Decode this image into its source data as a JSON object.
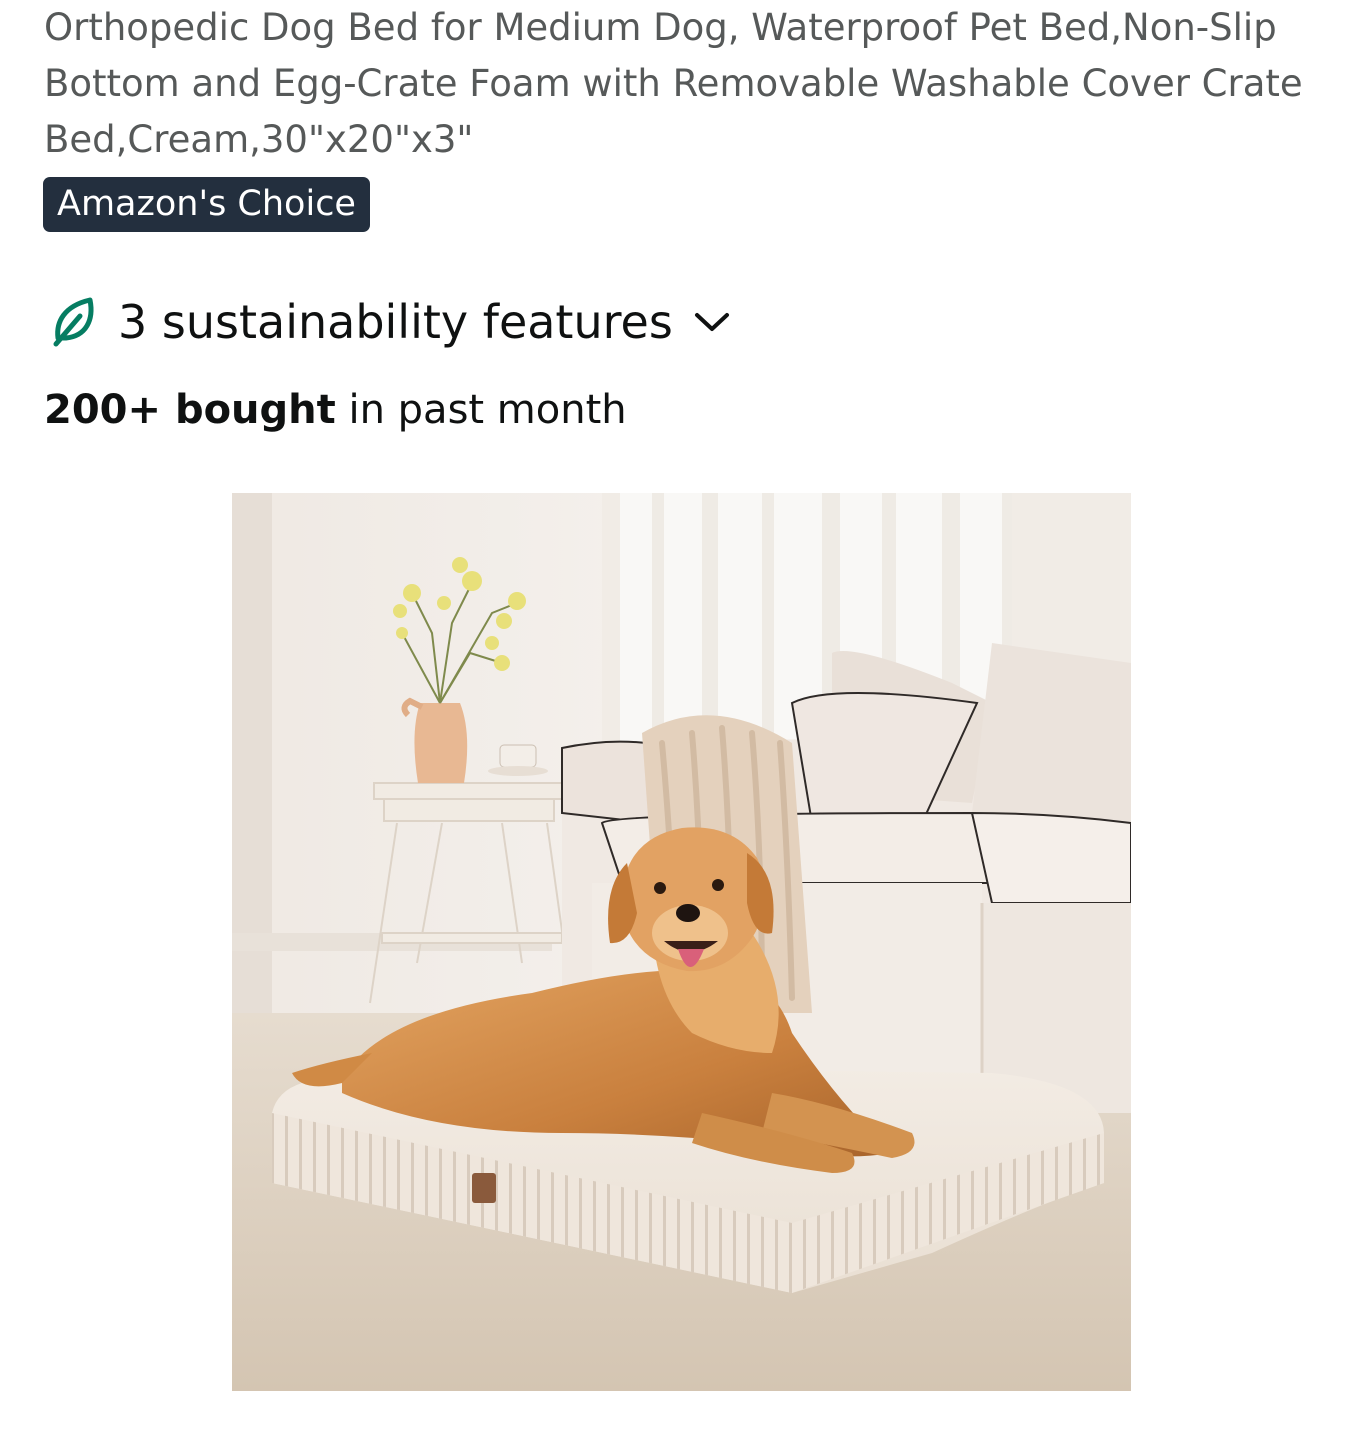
{
  "product": {
    "title": "Orthopedic Dog Bed for Medium Dog, Waterproof Pet Bed,Non-Slip Bottom and Egg-Crate Foam with Removable Washable Cover Crate Bed,Cream,30\"x20\"x3\"",
    "badge": "Amazon's Choice",
    "sustainability_label": "3 sustainability features",
    "sustainability_icon": "leaf-icon",
    "bought_count": "200+ bought",
    "bought_suffix": " in past month",
    "image_alt": "Golden retriever lying on a cream ribbed orthopedic dog bed in a living room"
  },
  "colors": {
    "badge_bg": "#232f3e",
    "badge_text": "#ffffff",
    "title_text": "#565959",
    "leaf_green": "#067d62"
  }
}
